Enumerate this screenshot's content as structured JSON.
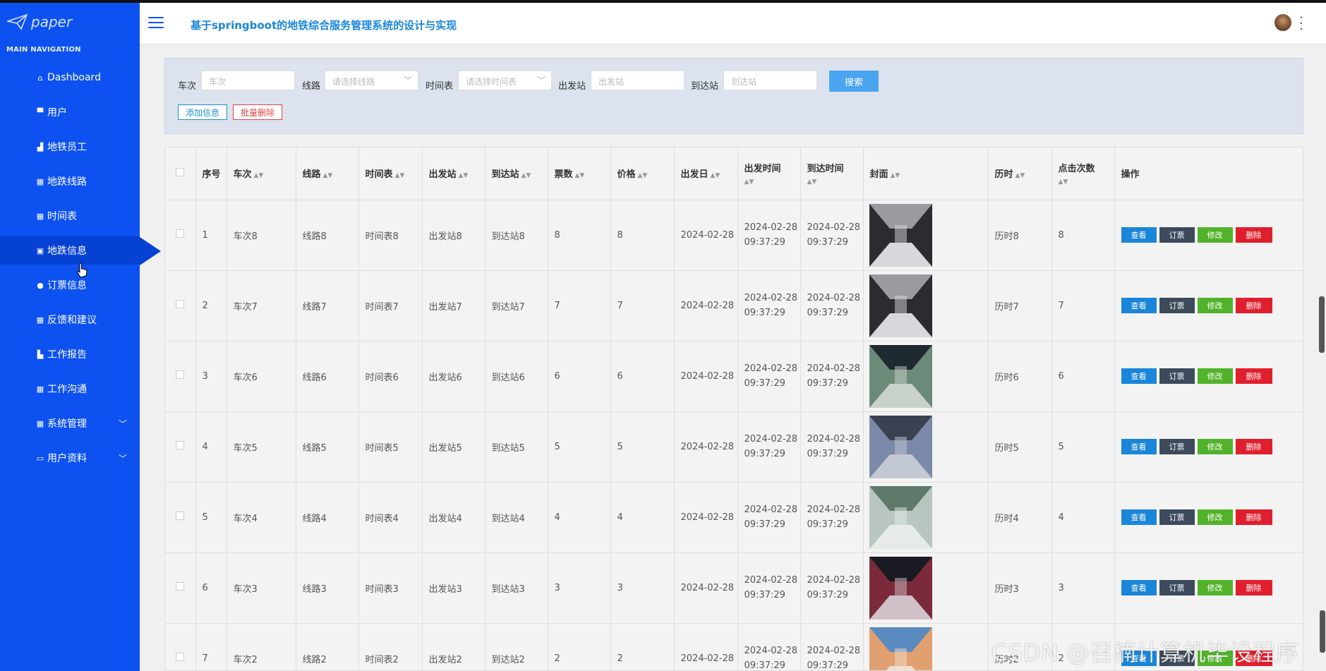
{
  "app": {
    "logo_text": "paper",
    "title": "基于springboot的地铁综合服务管理系统的设计与实现"
  },
  "sidebar": {
    "section_title": "MAIN NAVIGATION",
    "items": [
      {
        "label": "Dashboard",
        "icon": "home-icon"
      },
      {
        "label": "用户",
        "icon": "monitor-icon"
      },
      {
        "label": "地铁员工",
        "icon": "thumb-icon"
      },
      {
        "label": "地跌线路",
        "icon": "grid-icon"
      },
      {
        "label": "时间表",
        "icon": "grid-icon"
      },
      {
        "label": "地跌信息",
        "icon": "doc-icon",
        "active": true
      },
      {
        "label": "订票信息",
        "icon": "pin-icon"
      },
      {
        "label": "反馈和建议",
        "icon": "grid-icon"
      },
      {
        "label": "工作报告",
        "icon": "report-icon"
      },
      {
        "label": "工作沟通",
        "icon": "grid-icon"
      },
      {
        "label": "系统管理",
        "icon": "grid-icon",
        "expandable": true
      },
      {
        "label": "用户资料",
        "icon": "card-icon",
        "expandable": true
      }
    ]
  },
  "search": {
    "train_label": "车次",
    "train_placeholder": "车次",
    "line_label": "线路",
    "line_placeholder": "请选择线路",
    "schedule_label": "时间表",
    "schedule_placeholder": "请选择时间表",
    "depart_label": "出发站",
    "depart_placeholder": "出发站",
    "arrive_label": "到达站",
    "arrive_placeholder": "到达站",
    "search_button": "搜索",
    "add_button": "添加信息",
    "batch_delete_button": "批量删除"
  },
  "table": {
    "headers": {
      "index": "序号",
      "train": "车次",
      "line": "线路",
      "schedule": "时间表",
      "depart": "出发站",
      "arrive": "到达站",
      "tickets": "票数",
      "price": "价格",
      "depart_date": "出发日",
      "depart_time": "出发时间",
      "arrive_time": "到达时间",
      "cover": "封面",
      "duration": "历时",
      "clicks": "点击次数",
      "actions": "操作"
    },
    "action_labels": {
      "view": "查看",
      "book": "订票",
      "edit": "修改",
      "delete": "删除"
    },
    "rows": [
      {
        "index": "1",
        "train": "车次8",
        "line": "线路8",
        "schedule": "时间表8",
        "depart": "出发站8",
        "arrive": "到达站8",
        "tickets": "8",
        "price": "8",
        "date": "2024-02-28",
        "dt_date": "2024-02-28",
        "dt_time": "09:37:29",
        "at_date": "2024-02-28",
        "at_time": "09:37:29",
        "duration": "历时8",
        "clicks": "8"
      },
      {
        "index": "2",
        "train": "车次7",
        "line": "线路7",
        "schedule": "时间表7",
        "depart": "出发站7",
        "arrive": "到达站7",
        "tickets": "7",
        "price": "7",
        "date": "2024-02-28",
        "dt_date": "2024-02-28",
        "dt_time": "09:37:29",
        "at_date": "2024-02-28",
        "at_time": "09:37:29",
        "duration": "历时7",
        "clicks": "7"
      },
      {
        "index": "3",
        "train": "车次6",
        "line": "线路6",
        "schedule": "时间表6",
        "depart": "出发站6",
        "arrive": "到达站6",
        "tickets": "6",
        "price": "6",
        "date": "2024-02-28",
        "dt_date": "2024-02-28",
        "dt_time": "09:37:29",
        "at_date": "2024-02-28",
        "at_time": "09:37:29",
        "duration": "历时6",
        "clicks": "6"
      },
      {
        "index": "4",
        "train": "车次5",
        "line": "线路5",
        "schedule": "时间表5",
        "depart": "出发站5",
        "arrive": "到达站5",
        "tickets": "5",
        "price": "5",
        "date": "2024-02-28",
        "dt_date": "2024-02-28",
        "dt_time": "09:37:29",
        "at_date": "2024-02-28",
        "at_time": "09:37:29",
        "duration": "历时5",
        "clicks": "5"
      },
      {
        "index": "5",
        "train": "车次4",
        "line": "线路4",
        "schedule": "时间表4",
        "depart": "出发站4",
        "arrive": "到达站4",
        "tickets": "4",
        "price": "4",
        "date": "2024-02-28",
        "dt_date": "2024-02-28",
        "dt_time": "09:37:29",
        "at_date": "2024-02-28",
        "at_time": "09:37:29",
        "duration": "历时4",
        "clicks": "4"
      },
      {
        "index": "6",
        "train": "车次3",
        "line": "线路3",
        "schedule": "时间表3",
        "depart": "出发站3",
        "arrive": "到达站3",
        "tickets": "3",
        "price": "3",
        "date": "2024-02-28",
        "dt_date": "2024-02-28",
        "dt_time": "09:37:29",
        "at_date": "2024-02-28",
        "at_time": "09:37:29",
        "duration": "历时3",
        "clicks": "3"
      },
      {
        "index": "7",
        "train": "车次2",
        "line": "线路2",
        "schedule": "时间表2",
        "depart": "出发站2",
        "arrive": "到达站2",
        "tickets": "2",
        "price": "2",
        "date": "2024-02-28",
        "dt_date": "2024-02-28",
        "dt_time": "09:37:29",
        "at_date": "2024-02-28",
        "at_time": "09:37:29",
        "duration": "历时2",
        "clicks": "2"
      }
    ]
  },
  "watermark": "CSDN @召楠计算机毕设程序",
  "colors": {
    "sidebar": "#0d52f0",
    "sidebar_active": "#0541d3",
    "title": "#1a86d9",
    "view": "#1a86d9",
    "book": "#3d4a5c",
    "edit": "#52b32b",
    "delete": "#e01f2e"
  }
}
